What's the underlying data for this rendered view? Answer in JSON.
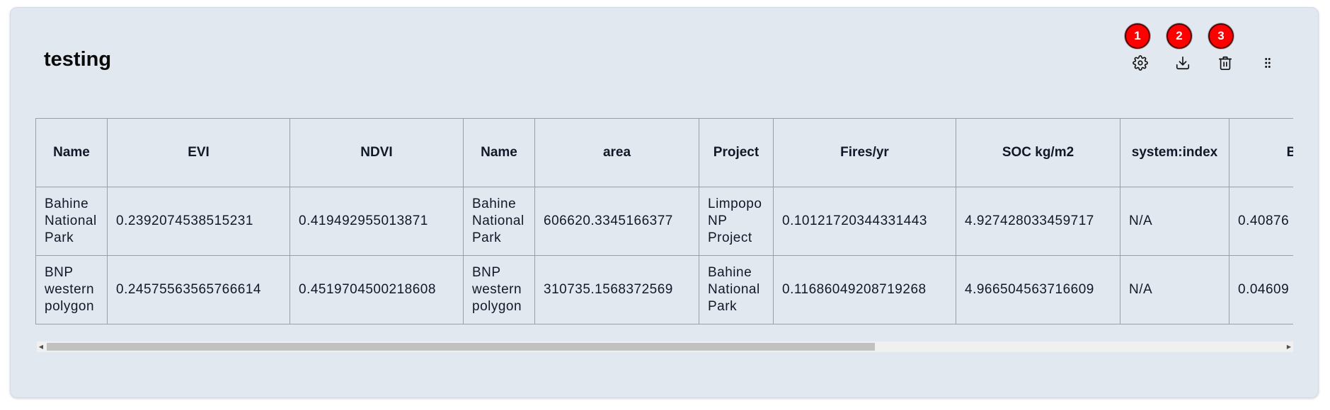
{
  "card": {
    "title": "testing"
  },
  "toolbar": {
    "settings_icon": "gear-icon",
    "download_icon": "download-icon",
    "delete_icon": "trash-icon",
    "drag_icon": "drag-handle-icon"
  },
  "markers": [
    "1",
    "2",
    "3"
  ],
  "table": {
    "columns": [
      "Name",
      "EVI",
      "NDVI",
      "Name",
      "area",
      "Project",
      "Fires/yr",
      "SOC kg/m2",
      "system:index",
      "Bar"
    ],
    "rows": [
      [
        "Bahine National Park",
        "0.2392074538515231",
        "0.419492955013871",
        "Bahine National Park",
        "606620.3345166377",
        "Limpopo NP Project",
        "0.10121720344331443",
        "4.927428033459717",
        "N/A",
        "0.40876"
      ],
      [
        "BNP western polygon",
        "0.24575563565766614",
        "0.4519704500218608",
        "BNP western polygon",
        "310735.1568372569",
        "Bahine National Park",
        "0.11686049208719268",
        "4.966504563716609",
        "N/A",
        "0.04609"
      ]
    ]
  },
  "scrollbar": {
    "left_arrow": "◀",
    "right_arrow": "▶",
    "position_fraction": 0.0,
    "visible_fraction": 0.66
  },
  "colors": {
    "card_background": "#e2e8f0",
    "marker": "#ff0000"
  }
}
